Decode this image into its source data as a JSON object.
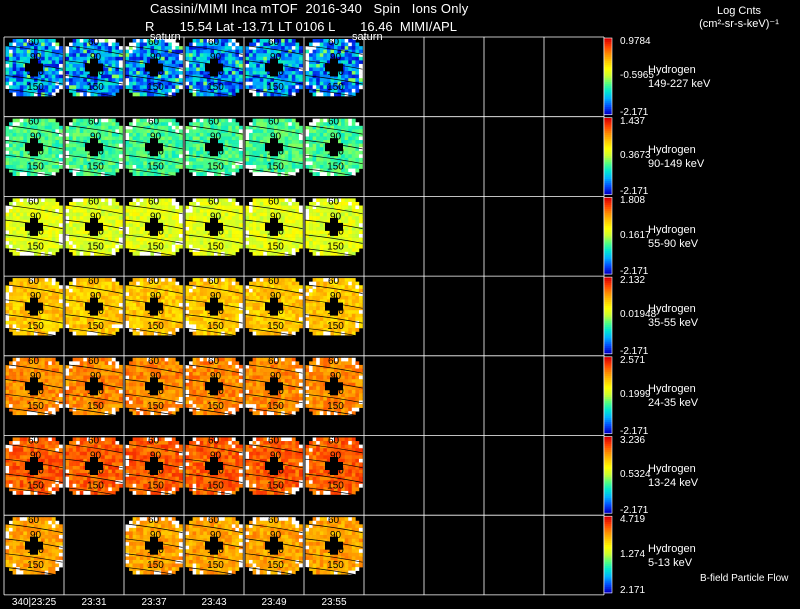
{
  "header": {
    "title": "Cassini/MIMI Inca mTOF  2016-340   Spin   Ions Only",
    "subtitle": "R       15.54 Lat -13.71 LT 0106 L       16.46  MIMI/APL",
    "units_title": "Log Cnts",
    "units_line": "(cm²-sr-s-keV)⁻¹",
    "sat_label": "saturn"
  },
  "footer": "B-field  Particle Flow",
  "chart_data": {
    "type": "heatmap",
    "title": "Cassini/MIMI Inca mTOF  2016-340   Spin   Ions Only",
    "times": [
      "340|23:25",
      "23:31",
      "23:37",
      "23:43",
      "23:49",
      "23:55"
    ],
    "columns_total": 10,
    "grid_labels": [
      "60",
      "90",
      "120",
      "150"
    ],
    "colormap": [
      "#0000c8",
      "#0050ff",
      "#00b0ff",
      "#00e8d0",
      "#50ff80",
      "#c8ff30",
      "#ffff00",
      "#ffc800",
      "#ff8c00",
      "#ff4000",
      "#d80000"
    ],
    "rows": [
      {
        "species": "Hydrogen",
        "energy": "149-227 keV",
        "max": "0.9784",
        "mid": "-0.5965",
        "min": "-2.171",
        "level": 0.18,
        "missing": []
      },
      {
        "species": "Hydrogen",
        "energy": "90-149 keV",
        "max": "1.437",
        "mid": "0.3673",
        "min": "-2.171",
        "level": 0.38,
        "missing": []
      },
      {
        "species": "Hydrogen",
        "energy": "55-90 keV",
        "max": "1.808",
        "mid": "0.1617",
        "min": "-2.171",
        "level": 0.55,
        "missing": []
      },
      {
        "species": "Hydrogen",
        "energy": "35-55 keV",
        "max": "2.132",
        "mid": "0.01948",
        "min": "-2.171",
        "level": 0.7,
        "missing": []
      },
      {
        "species": "Hydrogen",
        "energy": "24-35 keV",
        "max": "2.571",
        "mid": "0.1999",
        "min": "-2.171",
        "level": 0.8,
        "missing": []
      },
      {
        "species": "Hydrogen",
        "energy": "13-24 keV",
        "max": "3.236",
        "mid": "0.5324",
        "min": "-2.171",
        "level": 0.86,
        "missing": []
      },
      {
        "species": "Hydrogen",
        "energy": "5-13 keV",
        "max": "4.719",
        "mid": "1.274",
        "min": "2.171",
        "level": 0.76,
        "missing": [
          1
        ]
      }
    ]
  }
}
